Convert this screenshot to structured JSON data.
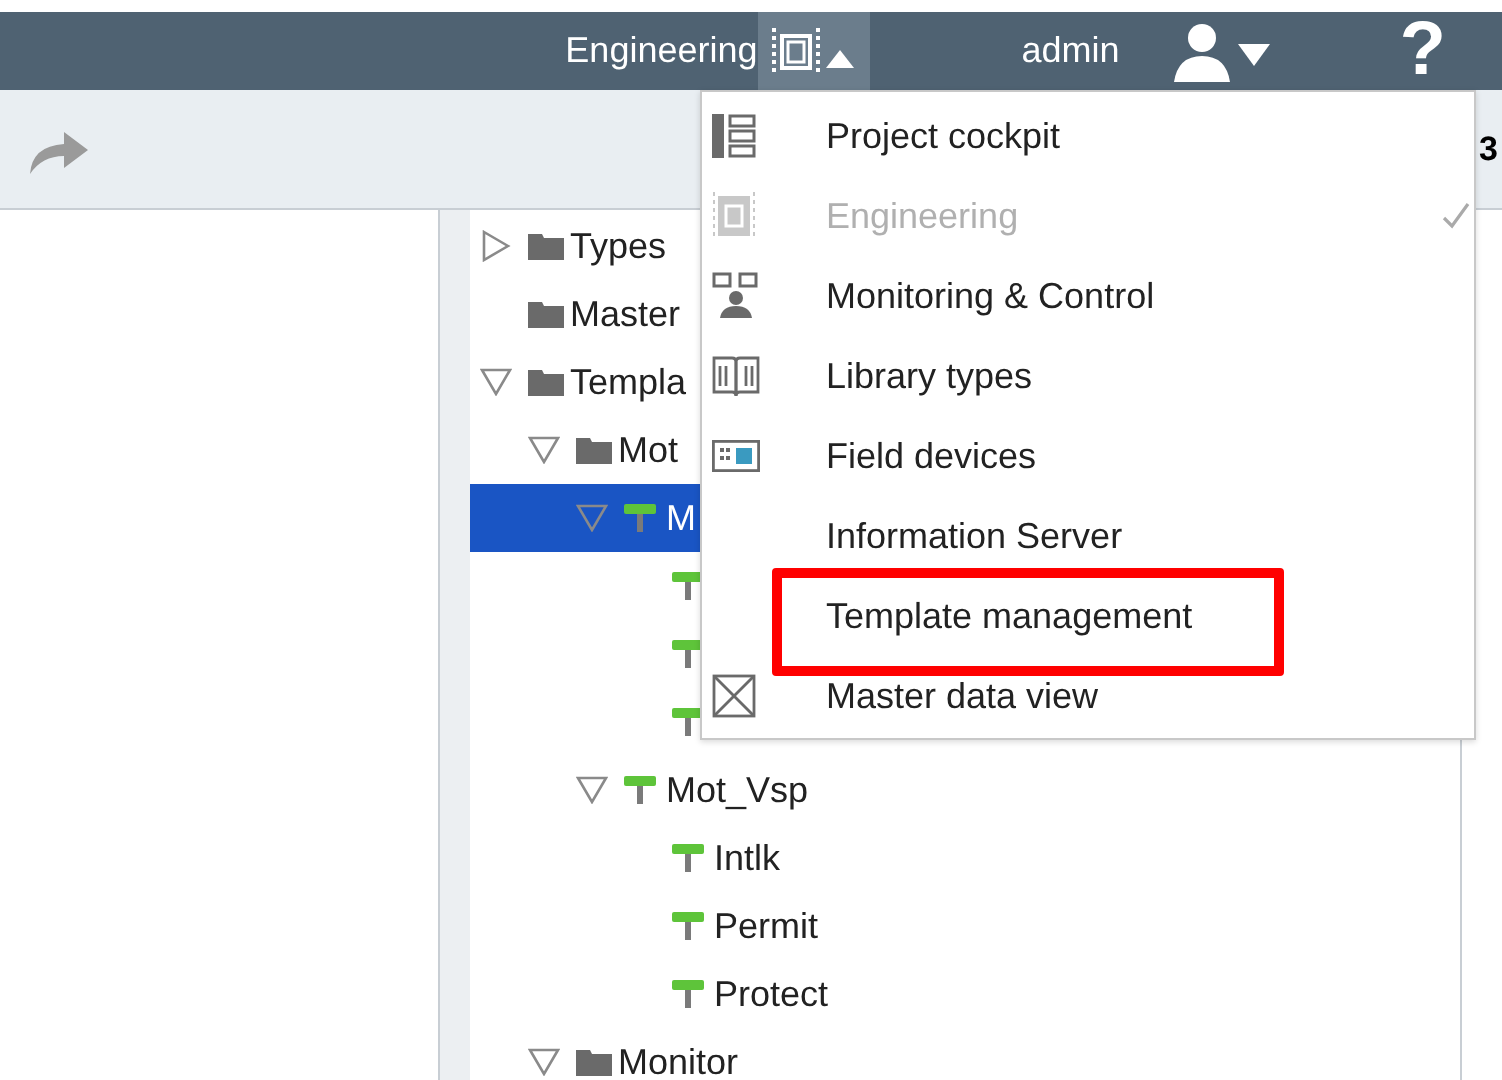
{
  "top_bar": {
    "perspective": "Engineering",
    "user": "admin",
    "help": "?"
  },
  "toolbar": {
    "text": "3"
  },
  "tree": [
    {
      "label": "Types",
      "kind": "folder",
      "expanded": false,
      "selected": false
    },
    {
      "label": "Master",
      "kind": "folder",
      "selected": false
    },
    {
      "label": "Templa",
      "kind": "folder",
      "expanded": true,
      "selected": false,
      "children": [
        {
          "label": "Mot",
          "kind": "folder",
          "expanded": true,
          "selected": false,
          "children": [
            {
              "label": "M",
              "kind": "block",
              "expanded": true,
              "selected": true,
              "children": [
                {
                  "kind": "block",
                  "selected": false
                },
                {
                  "kind": "block",
                  "selected": false
                },
                {
                  "kind": "block",
                  "selected": false
                }
              ]
            },
            {
              "label": "Mot_Vsp",
              "kind": "block",
              "expanded": true,
              "selected": false,
              "children": [
                {
                  "label": "Intlk",
                  "kind": "block",
                  "selected": false
                },
                {
                  "label": "Permit",
                  "kind": "block",
                  "selected": false
                },
                {
                  "label": "Protect",
                  "kind": "block",
                  "selected": false
                }
              ]
            }
          ]
        },
        {
          "label": "Monitor",
          "kind": "folder",
          "expanded": true,
          "selected": false
        }
      ]
    }
  ],
  "menu": [
    {
      "label": "Project cockpit",
      "kind": "cockpit",
      "selected": false,
      "disabled": false,
      "highlighted": false
    },
    {
      "label": "Engineering",
      "kind": "engineering",
      "selected": true,
      "disabled": true,
      "highlighted": false
    },
    {
      "label": "Monitoring & Control",
      "kind": "monitoring",
      "selected": false,
      "disabled": false,
      "highlighted": false
    },
    {
      "label": "Library types",
      "kind": "library",
      "selected": false,
      "disabled": false,
      "highlighted": false
    },
    {
      "label": "Field devices",
      "kind": "field",
      "selected": false,
      "disabled": false,
      "highlighted": false
    },
    {
      "label": "Information Server",
      "kind": "none",
      "selected": false,
      "disabled": false,
      "highlighted": false
    },
    {
      "label": "Template management",
      "kind": "none",
      "selected": false,
      "disabled": false,
      "highlighted": true
    },
    {
      "label": "Master data view",
      "kind": "master",
      "selected": false,
      "disabled": false,
      "highlighted": false
    }
  ]
}
